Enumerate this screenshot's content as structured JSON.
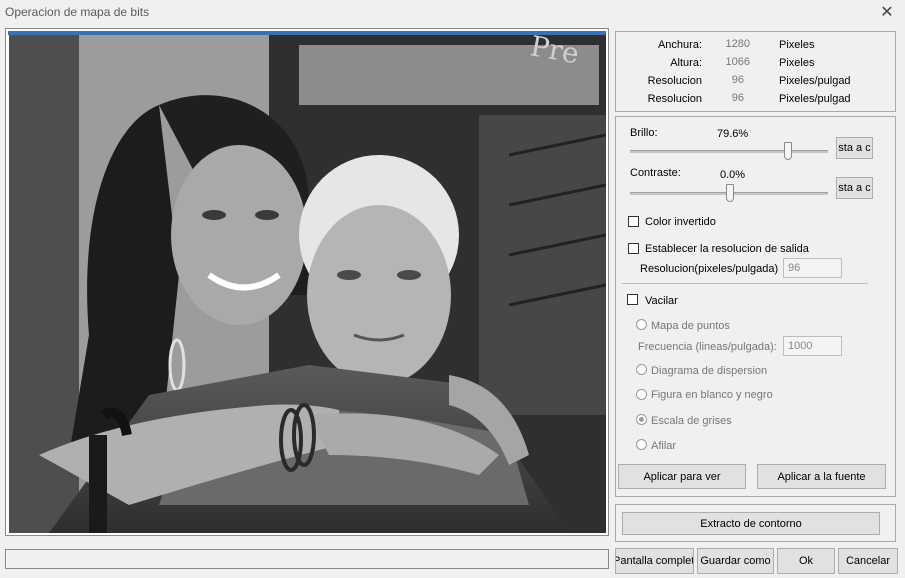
{
  "window": {
    "title": "Operacion de mapa de bits",
    "close_glyph": "✕"
  },
  "info": {
    "rows": [
      {
        "label": "Anchura:",
        "value": "1280",
        "unit": "Pixeles"
      },
      {
        "label": "Altura:",
        "value": "1066",
        "unit": "Pixeles"
      },
      {
        "label": "Resolucion",
        "value": "96",
        "unit": "Pixeles/pulgad"
      },
      {
        "label": "Resolucion",
        "value": "96",
        "unit": "Pixeles/pulgad"
      }
    ]
  },
  "adjust": {
    "brightness": {
      "label": "Brillo:",
      "value_text": "79.6%",
      "level": 0.796,
      "button": "sta a c"
    },
    "contrast": {
      "label": "Contraste:",
      "value_text": "0.0%",
      "level": 0.0,
      "button": "sta a c"
    },
    "invert_label": "Color invertido",
    "output_res_label": "Establecer la resolucion de salida",
    "res_field_label": "Resolucion(pixeles/pulgada)",
    "res_field_value": "96",
    "dither_label": "Vacilar",
    "dither_options": [
      {
        "label": "Mapa de puntos",
        "selected": false
      },
      {
        "label": "Diagrama de dispersion",
        "selected": false
      },
      {
        "label": "Figura en blanco y negro",
        "selected": false
      },
      {
        "label": "Escala de grises",
        "selected": true
      },
      {
        "label": "Afilar",
        "selected": false
      }
    ],
    "freq_label": "Frecuencia (lineas/pulgada):",
    "freq_value": "1000",
    "apply_view": "Aplicar para ver",
    "apply_source": "Aplicar a la fuente"
  },
  "contour_button": "Extracto de contorno",
  "footer": {
    "fullscreen": "Pantalla completa",
    "save_as": "Guardar como",
    "ok": "Ok",
    "cancel": "Cancelar"
  },
  "colors": {
    "accent": "#3b6fb6"
  },
  "icons": {
    "close": "close-icon",
    "preview": "grayscale-photo-preview"
  }
}
